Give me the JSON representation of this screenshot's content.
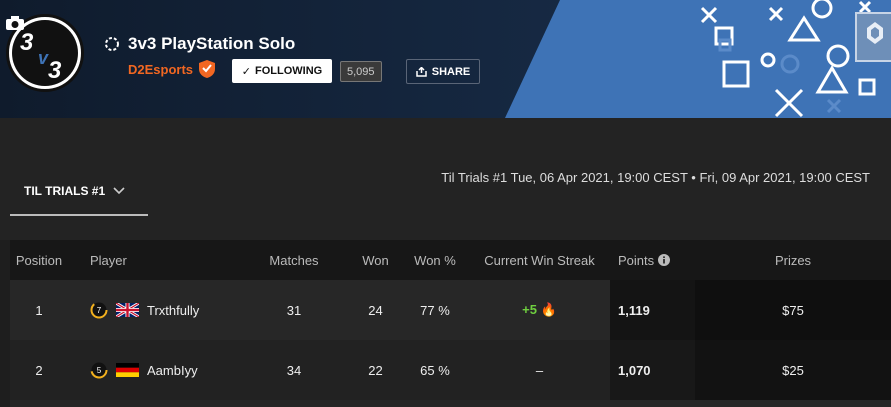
{
  "header": {
    "title": "3v3 PlayStation Solo",
    "organizer": "D2Esports",
    "follow_label": "FOLLOWING",
    "follower_count": "5,095",
    "share_label": "SHARE",
    "logo_text": "3v3"
  },
  "subbar": {
    "tab_label": "TIL TRIALS #1",
    "event_dates": "Til Trials #1  Tue, 06 Apr 2021, 19:00 CEST • Fri, 09 Apr 2021, 19:00 CEST"
  },
  "table": {
    "columns": {
      "position": "Position",
      "player": "Player",
      "matches": "Matches",
      "won": "Won",
      "won_pct": "Won %",
      "streak": "Current Win Streak",
      "points": "Points",
      "prizes": "Prizes"
    },
    "rows": [
      {
        "position": "1",
        "level": "7",
        "flag": "uk-flag-icon",
        "player": "Trxthfully",
        "matches": "31",
        "won": "24",
        "won_pct": "77 %",
        "streak": "+5",
        "points": "1,119",
        "prize": "$75"
      },
      {
        "position": "2",
        "level": "5",
        "flag": "germany-flag-icon",
        "player": "AambIyy",
        "matches": "34",
        "won": "22",
        "won_pct": "65 %",
        "streak": "–",
        "points": "1,070",
        "prize": "$25"
      }
    ]
  },
  "colors": {
    "header_bg": "#13233a",
    "accent_blue": "#3e73b6",
    "organizer_orange": "#f26722",
    "streak_green": "#6fcf3f"
  }
}
